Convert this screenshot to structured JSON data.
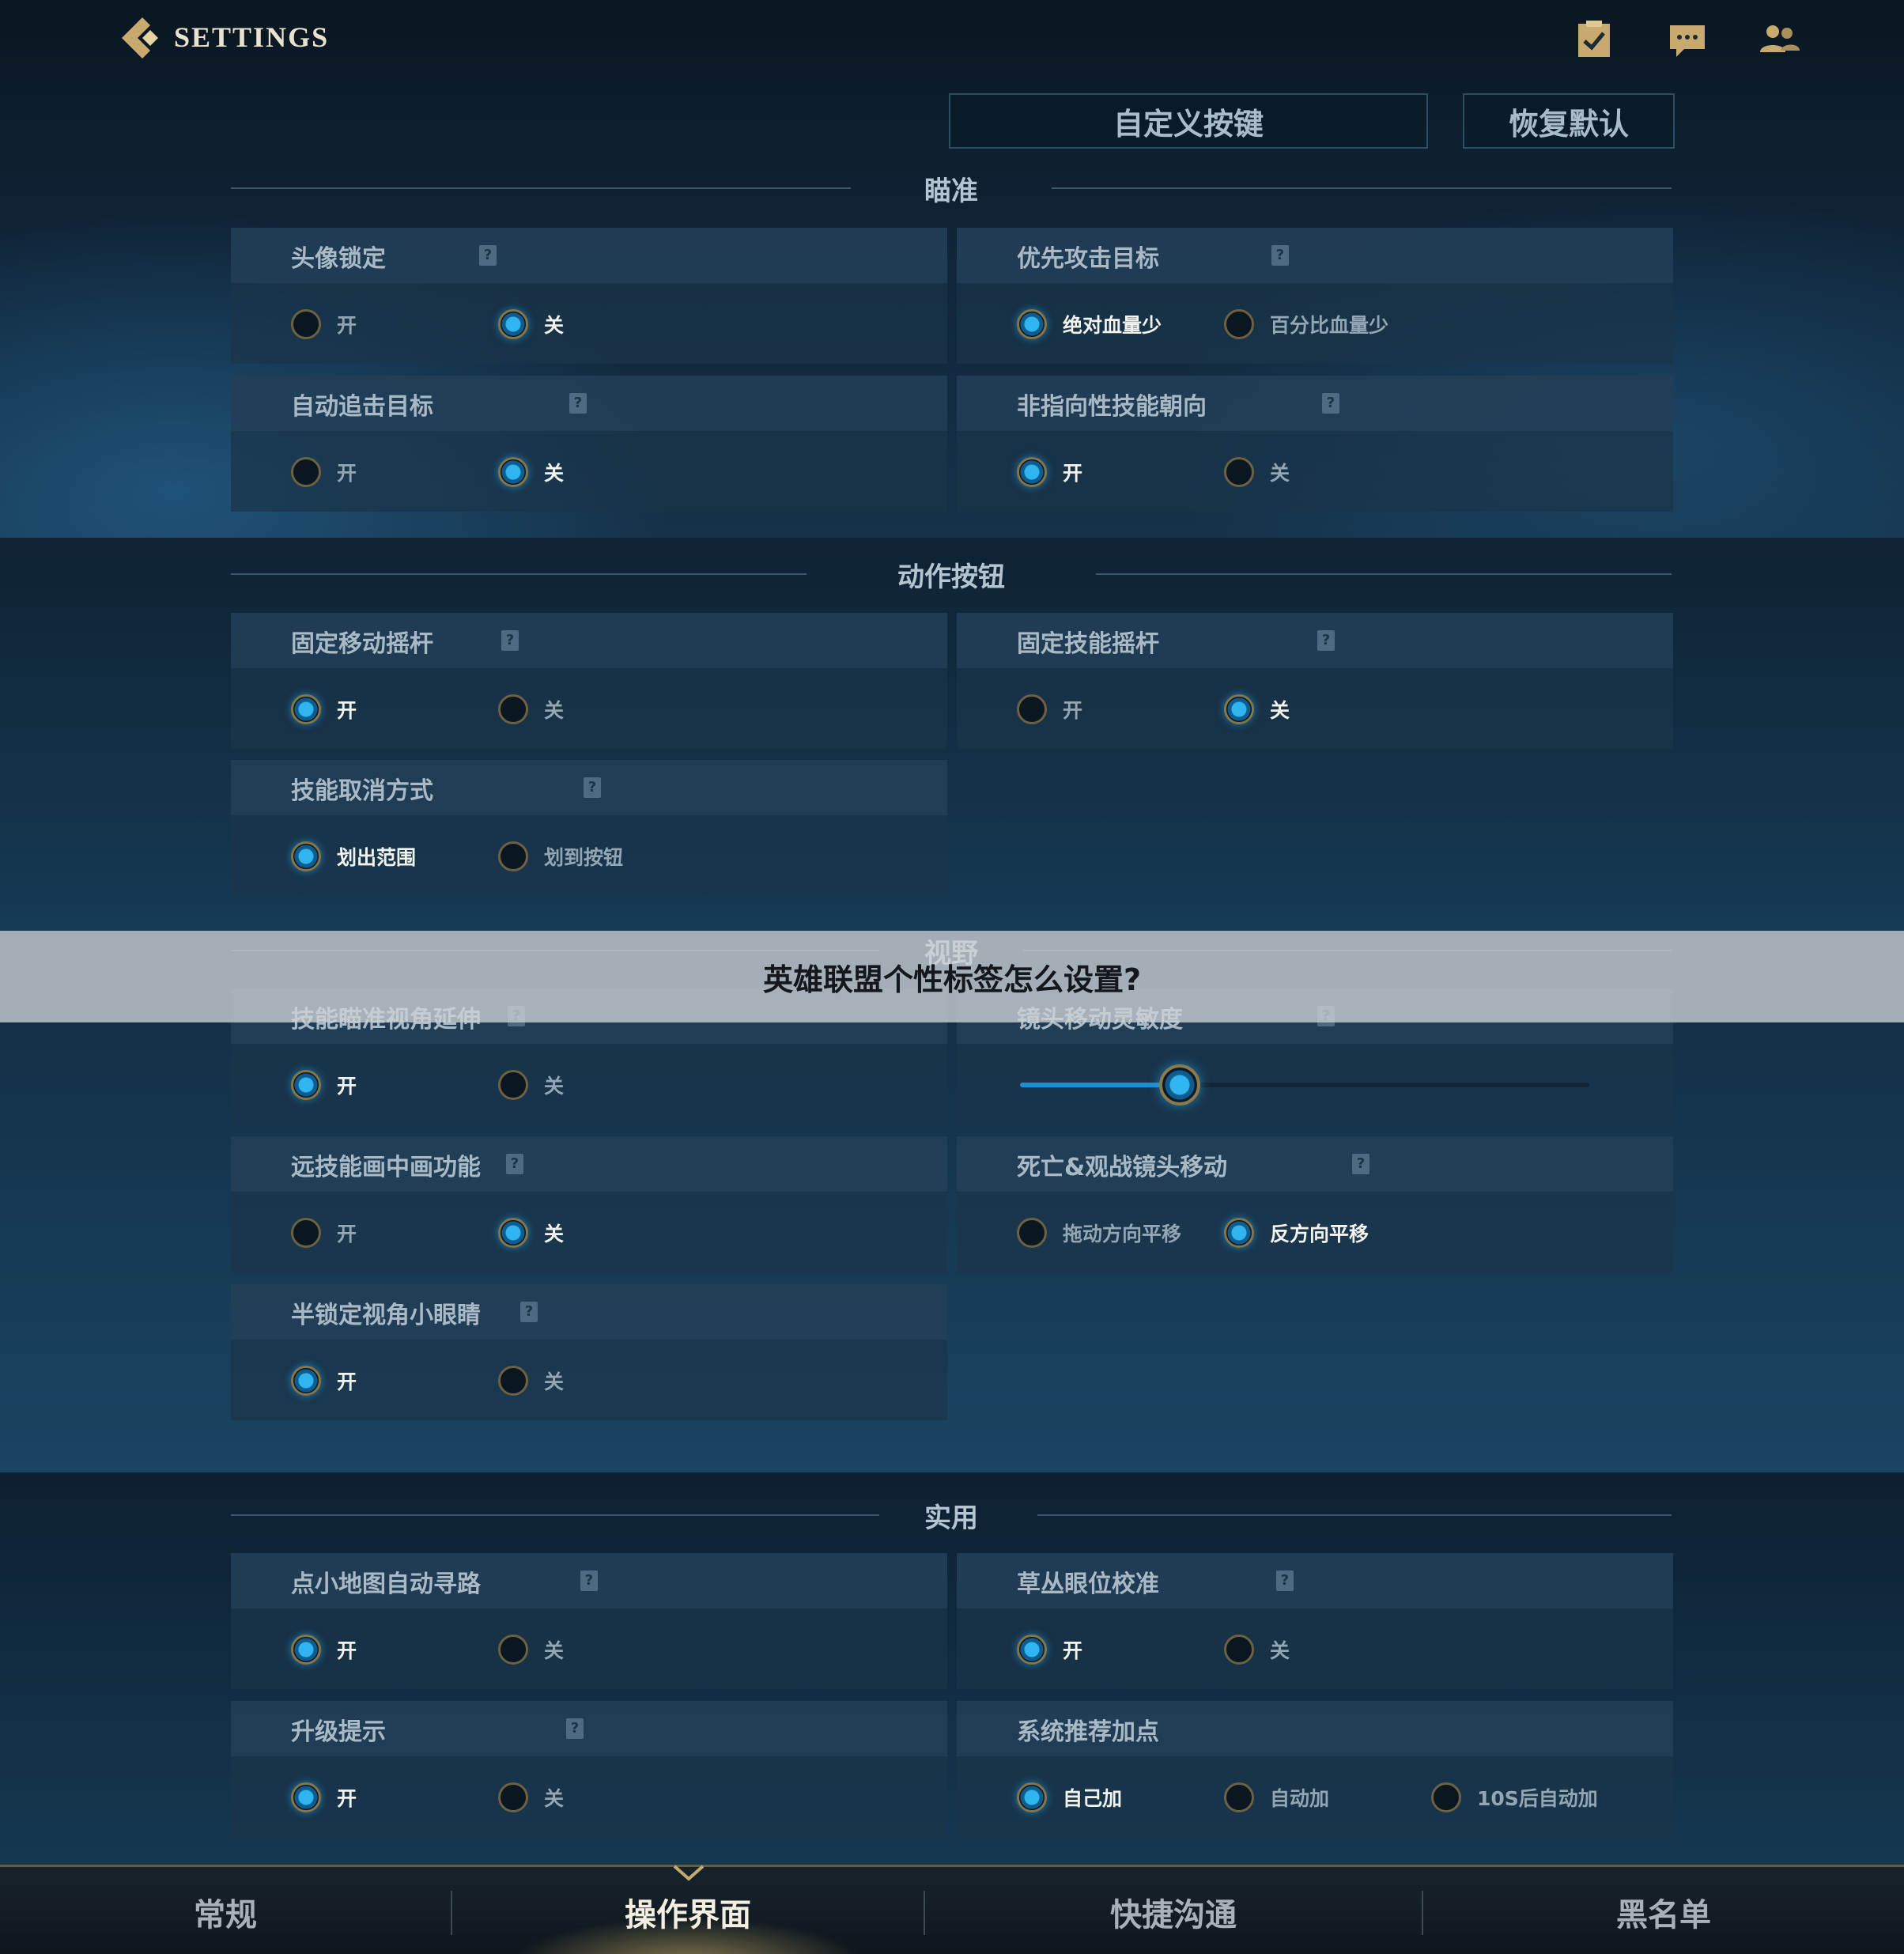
{
  "header": {
    "title": "SETTINGS",
    "icons": [
      "back-chevron-icon",
      "checklist-icon",
      "chat-icon",
      "friends-icon"
    ],
    "custom_keys_label": "自定义按键",
    "restore_default_label": "恢复默认"
  },
  "sections": {
    "aim": {
      "title": "瞄准",
      "cards": [
        {
          "label": "头像锁定",
          "options": [
            "开",
            "关"
          ],
          "selected": 1
        },
        {
          "label": "优先攻击目标",
          "options": [
            "绝对血量少",
            "百分比血量少"
          ],
          "selected": 0
        },
        {
          "label": "自动追击目标",
          "options": [
            "开",
            "关"
          ],
          "selected": 1
        },
        {
          "label": "非指向性技能朝向",
          "options": [
            "开",
            "关"
          ],
          "selected": 0
        }
      ]
    },
    "action": {
      "title": "动作按钮",
      "cards": [
        {
          "label": "固定移动摇杆",
          "options": [
            "开",
            "关"
          ],
          "selected": 0
        },
        {
          "label": "固定技能摇杆",
          "options": [
            "开",
            "关"
          ],
          "selected": 1
        },
        {
          "label": "技能取消方式",
          "options": [
            "划出范围",
            "划到按钮"
          ],
          "selected": 0
        }
      ]
    },
    "view": {
      "title": "视野",
      "cards": [
        {
          "label": "技能瞄准视角延伸",
          "options": [
            "开",
            "关"
          ],
          "selected": 0
        },
        {
          "label": "镜头移动灵敏度",
          "slider_value": 0.28
        },
        {
          "label": "远技能画中画功能",
          "options": [
            "开",
            "关"
          ],
          "selected": 1
        },
        {
          "label": "死亡&观战镜头移动",
          "options": [
            "拖动方向平移",
            "反方向平移"
          ],
          "selected": 1
        },
        {
          "label": "半锁定视角小眼睛",
          "options": [
            "开",
            "关"
          ],
          "selected": 0
        }
      ]
    },
    "utility": {
      "title": "实用",
      "cards": [
        {
          "label": "点小地图自动寻路",
          "options": [
            "开",
            "关"
          ],
          "selected": 0
        },
        {
          "label": "草丛眼位校准",
          "options": [
            "开",
            "关"
          ],
          "selected": 0
        },
        {
          "label": "升级提示",
          "options": [
            "开",
            "关"
          ],
          "selected": 0
        },
        {
          "label": "系统推荐加点",
          "options": [
            "自己加",
            "自动加",
            "10S后自动加"
          ],
          "selected": 0
        }
      ]
    }
  },
  "help_mark": "?",
  "banner": {
    "text": "英雄联盟个性标签怎么设置?"
  },
  "tabs": [
    {
      "label": "常规",
      "active": false
    },
    {
      "label": "操作界面",
      "active": true
    },
    {
      "label": "快捷沟通",
      "active": false
    },
    {
      "label": "黑名单",
      "active": false
    }
  ],
  "colors": {
    "accent_gold": "#c8aa6e",
    "radio_selected": "#2fb6f0",
    "panel_bg": "#1a344a",
    "page_bg": "#0c1a26"
  }
}
